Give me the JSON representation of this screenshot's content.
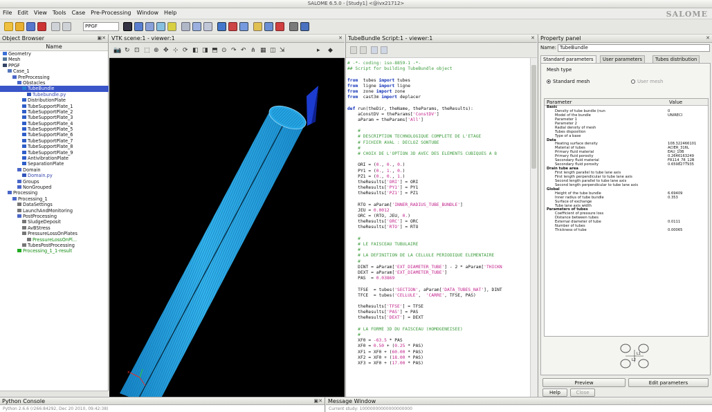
{
  "window": {
    "title": "SALOME 6.5.0 - [Study1] <@ivx21712>",
    "logo": "SALOME"
  },
  "menu": [
    "File",
    "Edit",
    "View",
    "Tools",
    "Case",
    "Pre-Processing",
    "Window",
    "Help"
  ],
  "toolbar": {
    "module_combo": "PPGF"
  },
  "object_browser": {
    "title": "Object Browser",
    "column_header": "Name",
    "nodes": [
      {
        "label": "Geometry",
        "depth": 0,
        "icon": "geometry-icon"
      },
      {
        "label": "Mesh",
        "depth": 0,
        "icon": "mesh-icon"
      },
      {
        "label": "PPGF",
        "depth": 0,
        "icon": "ppgf-icon"
      },
      {
        "label": "Case_1",
        "depth": 1,
        "icon": "case-icon"
      },
      {
        "label": "PreProcessing",
        "depth": 2,
        "icon": "folder-icon"
      },
      {
        "label": "Obstacles",
        "depth": 3,
        "icon": "folder-icon"
      },
      {
        "label": "TubeBundle",
        "depth": 4,
        "icon": "tube-bundle-icon",
        "selected": true
      },
      {
        "label": "Tubebundle.py",
        "depth": 5,
        "icon": "python-file-icon",
        "style": "purple"
      },
      {
        "label": "DistributionPlate",
        "depth": 4,
        "icon": "plate-icon"
      },
      {
        "label": "TubeSupportPlate_1",
        "depth": 4,
        "icon": "plate-icon"
      },
      {
        "label": "TubeSupportPlate_2",
        "depth": 4,
        "icon": "plate-icon"
      },
      {
        "label": "TubeSupportPlate_3",
        "depth": 4,
        "icon": "plate-icon"
      },
      {
        "label": "TubeSupportPlate_4",
        "depth": 4,
        "icon": "plate-icon"
      },
      {
        "label": "TubeSupportPlate_5",
        "depth": 4,
        "icon": "plate-icon"
      },
      {
        "label": "TubeSupportPlate_6",
        "depth": 4,
        "icon": "plate-icon"
      },
      {
        "label": "TubeSupportPlate_7",
        "depth": 4,
        "icon": "plate-icon"
      },
      {
        "label": "TubeSupportPlate_8",
        "depth": 4,
        "icon": "plate-icon"
      },
      {
        "label": "TubeSupportPlate_9",
        "depth": 4,
        "icon": "plate-icon"
      },
      {
        "label": "AntivibrationPlate",
        "depth": 4,
        "icon": "plate-icon"
      },
      {
        "label": "SeparationPlate",
        "depth": 4,
        "icon": "plate-icon"
      },
      {
        "label": "Domain",
        "depth": 3,
        "icon": "folder-icon"
      },
      {
        "label": "Domain.py",
        "depth": 4,
        "icon": "python-file-icon",
        "style": "purple"
      },
      {
        "label": "Groups",
        "depth": 3,
        "icon": "folder-icon"
      },
      {
        "label": "NonGrouped",
        "depth": 3,
        "icon": "folder-icon"
      },
      {
        "label": "Processing",
        "depth": 1,
        "icon": "folder-icon"
      },
      {
        "label": "Processing_1",
        "depth": 2,
        "icon": "folder-icon"
      },
      {
        "label": "DataSettings",
        "depth": 3,
        "icon": "settings-icon"
      },
      {
        "label": "LaunchAndMonitoring",
        "depth": 3,
        "icon": "launch-icon"
      },
      {
        "label": "PostProcessing",
        "depth": 3,
        "icon": "folder-icon"
      },
      {
        "label": "SludgeDeposit",
        "depth": 4,
        "icon": "result-icon"
      },
      {
        "label": "AvBStress",
        "depth": 4,
        "icon": "result-icon"
      },
      {
        "label": "PressureLossOnPlates",
        "depth": 4,
        "icon": "result-icon"
      },
      {
        "label": "PressureLossOnPl...",
        "depth": 5,
        "icon": "result-icon",
        "style": "green"
      },
      {
        "label": "TubesPostProcessing",
        "depth": 4,
        "icon": "result-icon"
      },
      {
        "label": "Processing_1_1-result",
        "depth": 3,
        "icon": "star-icon",
        "style": "green"
      }
    ]
  },
  "viewer": {
    "title": "VTK scene:1 - viewer:1"
  },
  "script": {
    "title": "TubeBundle Script:1 - viewer:1",
    "lines": [
      [
        [
          "cm",
          "# -*- coding: iso-8859-1 -*-"
        ]
      ],
      [
        [
          "cm",
          "## Script for building TubeBundle object"
        ]
      ],
      [],
      [
        [
          "kw",
          "from"
        ],
        [
          "",
          "  tubes "
        ],
        [
          "kw",
          "import"
        ],
        [
          "",
          " tubes"
        ]
      ],
      [
        [
          "kw",
          "from"
        ],
        [
          "",
          "  ligne "
        ],
        [
          "kw",
          "import"
        ],
        [
          "",
          " ligne"
        ]
      ],
      [
        [
          "kw",
          "from"
        ],
        [
          "",
          "  zone "
        ],
        [
          "kw",
          "import"
        ],
        [
          "",
          " zone"
        ]
      ],
      [
        [
          "kw",
          "from"
        ],
        [
          "",
          "  cast3m "
        ],
        [
          "kw",
          "import"
        ],
        [
          "",
          " deplacer"
        ]
      ],
      [],
      [
        [
          "kw",
          "def"
        ],
        [
          "",
          " run(theDir, theName, theParams, theResults):"
        ]
      ],
      [
        [
          "",
          "    aConstDV = theParams["
        ],
        [
          "st",
          "'ConstDV'"
        ],
        [
          "",
          "]"
        ]
      ],
      [
        [
          "",
          "    aParam = theParams["
        ],
        [
          "st",
          "'All'"
        ],
        [
          "",
          "]"
        ]
      ],
      [],
      [
        [
          "cm",
          "    #"
        ]
      ],
      [
        [
          "cm",
          "    # DESCRIPTION TECHNOLOGIQUE COMPLETE DE L'ETAGE"
        ]
      ],
      [
        [
          "cm",
          "    # FICHIER AVAL : DECLOZ SONTUBE"
        ]
      ],
      [
        [
          "cm",
          "    #"
        ]
      ],
      [
        [
          "cm",
          "    # CHOIX DE L'OPTION 3D AVEC DES ELEMENTS CUBIQUES A 8"
        ]
      ],
      [],
      [
        [
          "",
          "    ORI = ("
        ],
        [
          "st",
          "0."
        ],
        [
          "",
          ", "
        ],
        [
          "st",
          "0."
        ],
        [
          "",
          ", "
        ],
        [
          "st",
          "0."
        ],
        [
          "",
          ")"
        ]
      ],
      [
        [
          "",
          "    PY1 = ("
        ],
        [
          "st",
          "0."
        ],
        [
          "",
          ", "
        ],
        [
          "st",
          "1."
        ],
        [
          "",
          ", "
        ],
        [
          "st",
          "0."
        ],
        [
          "",
          ")"
        ]
      ],
      [
        [
          "",
          "    PZ1 = ("
        ],
        [
          "st",
          "0."
        ],
        [
          "",
          ", "
        ],
        [
          "st",
          "0."
        ],
        [
          "",
          ", "
        ],
        [
          "st",
          "1."
        ],
        [
          "",
          ")"
        ]
      ],
      [
        [
          "",
          "    theResults["
        ],
        [
          "st",
          "'ORI'"
        ],
        [
          "",
          "] = ORI"
        ]
      ],
      [
        [
          "",
          "    theResults["
        ],
        [
          "st",
          "'PY1'"
        ],
        [
          "",
          "] = PY1"
        ]
      ],
      [
        [
          "",
          "    theResults["
        ],
        [
          "st",
          "'PZ1'"
        ],
        [
          "",
          "] = PZ1"
        ]
      ],
      [],
      [
        [
          "",
          "    RTO = aParam["
        ],
        [
          "st",
          "'INNER_RADIUS_TUBE_BUNDLE'"
        ],
        [
          "",
          "]"
        ]
      ],
      [
        [
          "",
          "    JEU = "
        ],
        [
          "st",
          "0.0012"
        ]
      ],
      [
        [
          "",
          "    ORC = (RTO, JEU, "
        ],
        [
          "st",
          "0."
        ],
        [
          "",
          ")"
        ]
      ],
      [
        [
          "",
          "    theResults["
        ],
        [
          "st",
          "'ORC'"
        ],
        [
          "",
          "] = ORC"
        ]
      ],
      [
        [
          "",
          "    theResults["
        ],
        [
          "st",
          "'RTO'"
        ],
        [
          "",
          "] = RTO"
        ]
      ],
      [],
      [
        [
          "cm",
          "    #"
        ]
      ],
      [
        [
          "cm",
          "    # LE FAISCEAU TUBULAIRE"
        ]
      ],
      [
        [
          "cm",
          "    #"
        ]
      ],
      [
        [
          "cm",
          "    # LA DEFINITION DE LA CELLULE PERIODIQUE ELEMENTAIRE"
        ]
      ],
      [
        [
          "cm",
          "    #"
        ]
      ],
      [
        [
          "",
          "    DINT = aParam["
        ],
        [
          "st",
          "'EXT_DIAMETER_TUBE'"
        ],
        [
          "",
          "] - 2 * aParam["
        ],
        [
          "st",
          "'THICKN"
        ]
      ],
      [
        [
          "",
          "    DEXT = aParam["
        ],
        [
          "st",
          "'EXT_DIAMETER_TUBE'"
        ],
        [
          "",
          "]"
        ]
      ],
      [
        [
          "",
          "    PAS  = "
        ],
        [
          "st",
          "0.03869"
        ]
      ],
      [],
      [
        [
          "",
          "    TFSE  = tubes("
        ],
        [
          "st",
          "'SECTION'"
        ],
        [
          "",
          ", aParam["
        ],
        [
          "st",
          "'DATA_TUBES_NAT'"
        ],
        [
          "",
          "], DINT"
        ]
      ],
      [
        [
          "",
          "    TFCE  = tubes("
        ],
        [
          "st",
          "'CELLULE'"
        ],
        [
          "",
          ",  "
        ],
        [
          "st",
          "'CARRE'"
        ],
        [
          "",
          ", TFSE, PAS)"
        ]
      ],
      [],
      [
        [
          "",
          "    theResults["
        ],
        [
          "st",
          "'TFSE'"
        ],
        [
          "",
          "] = TFSE"
        ]
      ],
      [
        [
          "",
          "    theResults["
        ],
        [
          "st",
          "'PAS'"
        ],
        [
          "",
          "] = PAS"
        ]
      ],
      [
        [
          "",
          "    theResults["
        ],
        [
          "st",
          "'DEXT'"
        ],
        [
          "",
          "] = DEXT"
        ]
      ],
      [],
      [
        [
          "cm",
          "    # LA FORME 3D DU FAISCEAU (HOMOGENEISEE)"
        ]
      ],
      [
        [
          "cm",
          "    #"
        ]
      ],
      [
        [
          "",
          "    XF0 = "
        ],
        [
          "st",
          "-63.5"
        ],
        [
          "",
          " * PAS"
        ]
      ],
      [
        [
          "",
          "    XF0 = "
        ],
        [
          "st",
          "0.50"
        ],
        [
          "",
          " + ("
        ],
        [
          "st",
          "0.25"
        ],
        [
          "",
          " * PAS)"
        ]
      ],
      [
        [
          "",
          "    XF1 = XF0 + ("
        ],
        [
          "st",
          "60.00"
        ],
        [
          "",
          " * PAS)"
        ]
      ],
      [
        [
          "",
          "    XF2 = XF0 + ("
        ],
        [
          "st",
          "18.00"
        ],
        [
          "",
          " * PAS)"
        ]
      ],
      [
        [
          "",
          "    XF3 = XF0 + ("
        ],
        [
          "st",
          "17.00"
        ],
        [
          "",
          " * PAS)"
        ]
      ]
    ]
  },
  "property_panel": {
    "title": "Property panel",
    "name_label": "Name:",
    "name_value": "TubeBundle",
    "tabs": [
      "Standard parameters",
      "User parameters",
      "Tubes distribution"
    ],
    "mesh_type_label": "Mesh type",
    "radio_standard": "Standard mesh",
    "radio_user": "User mesh",
    "table_headers": {
      "parameter": "Parameter",
      "value": "Value"
    },
    "rows": [
      {
        "k": "Basic",
        "v": "",
        "grp": true,
        "d": 0
      },
      {
        "k": "Density of tube bundle (nun",
        "v": "0",
        "d": 1
      },
      {
        "k": "Model of the bundle",
        "v": "UNIRECI",
        "d": 1
      },
      {
        "k": "Parameter 1",
        "v": "",
        "d": 1
      },
      {
        "k": "Parameter 2",
        "v": "",
        "d": 1
      },
      {
        "k": "Radial density of mesh",
        "v": "",
        "d": 1
      },
      {
        "k": "Tubes disposition",
        "v": "",
        "d": 1
      },
      {
        "k": "Type of a base",
        "v": "",
        "d": 1
      },
      {
        "k": "Data",
        "v": "",
        "grp": true,
        "d": 0
      },
      {
        "k": "Heating surface density",
        "v": "108.322466101",
        "d": 1
      },
      {
        "k": "Material of tubes",
        "v": "ACIER_316L",
        "d": 1
      },
      {
        "k": "Primary fluid material",
        "v": "EAU_10B",
        "d": 1
      },
      {
        "k": "Primary fluid porosity",
        "v": "0.2646163249",
        "d": 1
      },
      {
        "k": "Secondary fluid material",
        "v": "FR114_78_12B",
        "d": 1
      },
      {
        "k": "Secondary fluid porosity",
        "v": "0.6598277935",
        "d": 1
      },
      {
        "k": "Drain tube area",
        "v": "",
        "grp": true,
        "d": 0
      },
      {
        "k": "First length parallel to tube lane axis",
        "v": "",
        "d": 1
      },
      {
        "k": "First length perpendicular to tube lane axis",
        "v": "",
        "d": 1
      },
      {
        "k": "Second length parallel to tube lane axis",
        "v": "",
        "d": 1
      },
      {
        "k": "Second length perpendicular to tube lane axis",
        "v": "",
        "d": 1
      },
      {
        "k": "Global",
        "v": "",
        "grp": true,
        "d": 0
      },
      {
        "k": "Height of the tube bundle",
        "v": "6.69409",
        "d": 1
      },
      {
        "k": "Inner radius of tube bundle",
        "v": "0.353",
        "d": 1
      },
      {
        "k": "Surface of exchange",
        "v": "",
        "d": 1
      },
      {
        "k": "Tube lane axis width",
        "v": "",
        "d": 1
      },
      {
        "k": "Parameters of tubes",
        "v": "",
        "grp": true,
        "d": 0
      },
      {
        "k": "Coefficient of pressure loss",
        "v": "",
        "d": 1
      },
      {
        "k": "Distance between tubes",
        "v": "",
        "d": 1
      },
      {
        "k": "External diameter of tube",
        "v": "0.0111",
        "d": 1
      },
      {
        "k": "Number of tubes",
        "v": "",
        "d": 1
      },
      {
        "k": "Thickness of tube",
        "v": "0.00065",
        "d": 1
      }
    ],
    "schema_labels": {
      "l1": "L1",
      "l2": "L2"
    },
    "buttons": {
      "preview": "Preview",
      "edit": "Edit parameters",
      "help": "Help",
      "close": "Close"
    }
  },
  "bottom": {
    "python_console_title": "Python Console",
    "python_console_line": "Python 2.6.6 (r266:84292, Dec 20 2010, 09:42:38)",
    "message_window_title": "Message Window",
    "message_line": "Current study: 10000000000000000000"
  },
  "colors": {
    "tube": "#29a9e6",
    "tube_dark": "#1683c2",
    "selection": "#3a55c8",
    "keyword": "#0a2bb5",
    "comment": "#3a9a3a",
    "string": "#c0208a"
  }
}
